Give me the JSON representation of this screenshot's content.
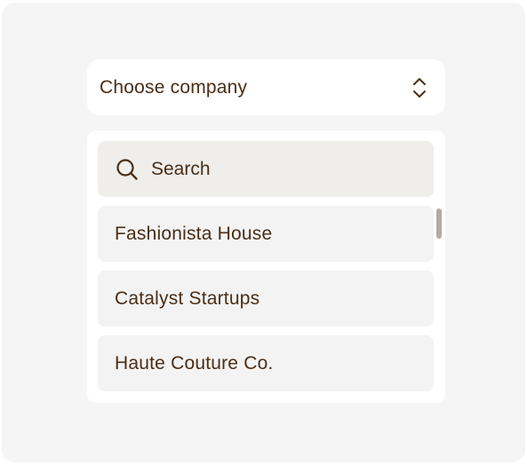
{
  "select": {
    "label": "Choose company",
    "icon": "chevron-up-down-icon"
  },
  "dropdown": {
    "search": {
      "placeholder": "Search",
      "icon": "search-icon"
    },
    "options": [
      {
        "label": "Fashionista House"
      },
      {
        "label": "Catalyst Startups"
      },
      {
        "label": "Haute Couture Co."
      }
    ]
  },
  "colors": {
    "background": "#f5f5f5",
    "surface": "#ffffff",
    "text": "#4a2e16",
    "search_bg": "#efeeeb",
    "option_bg": "#f3f3f3",
    "scrollbar": "#b0aba4"
  }
}
